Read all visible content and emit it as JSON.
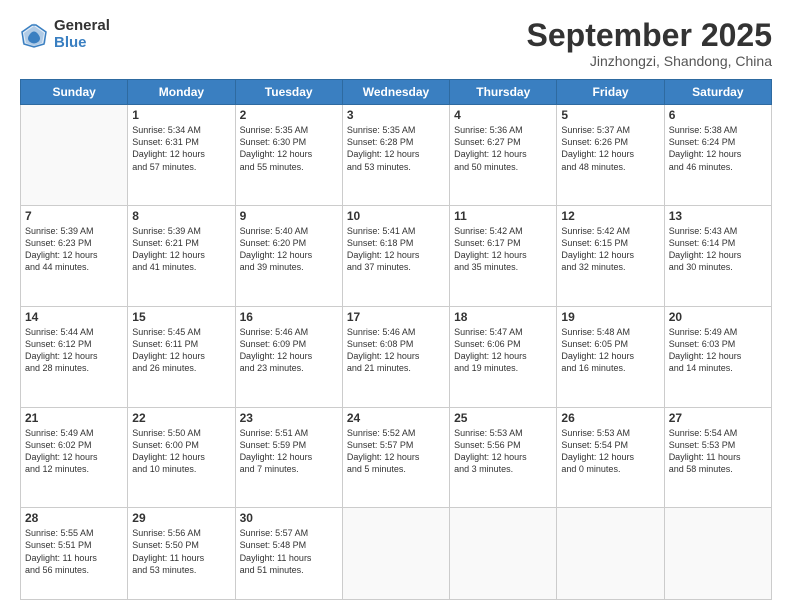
{
  "logo": {
    "general": "General",
    "blue": "Blue"
  },
  "header": {
    "month": "September 2025",
    "location": "Jinzhongzi, Shandong, China"
  },
  "weekdays": [
    "Sunday",
    "Monday",
    "Tuesday",
    "Wednesday",
    "Thursday",
    "Friday",
    "Saturday"
  ],
  "weeks": [
    [
      {
        "num": "",
        "text": ""
      },
      {
        "num": "1",
        "text": "Sunrise: 5:34 AM\nSunset: 6:31 PM\nDaylight: 12 hours\nand 57 minutes."
      },
      {
        "num": "2",
        "text": "Sunrise: 5:35 AM\nSunset: 6:30 PM\nDaylight: 12 hours\nand 55 minutes."
      },
      {
        "num": "3",
        "text": "Sunrise: 5:35 AM\nSunset: 6:28 PM\nDaylight: 12 hours\nand 53 minutes."
      },
      {
        "num": "4",
        "text": "Sunrise: 5:36 AM\nSunset: 6:27 PM\nDaylight: 12 hours\nand 50 minutes."
      },
      {
        "num": "5",
        "text": "Sunrise: 5:37 AM\nSunset: 6:26 PM\nDaylight: 12 hours\nand 48 minutes."
      },
      {
        "num": "6",
        "text": "Sunrise: 5:38 AM\nSunset: 6:24 PM\nDaylight: 12 hours\nand 46 minutes."
      }
    ],
    [
      {
        "num": "7",
        "text": "Sunrise: 5:39 AM\nSunset: 6:23 PM\nDaylight: 12 hours\nand 44 minutes."
      },
      {
        "num": "8",
        "text": "Sunrise: 5:39 AM\nSunset: 6:21 PM\nDaylight: 12 hours\nand 41 minutes."
      },
      {
        "num": "9",
        "text": "Sunrise: 5:40 AM\nSunset: 6:20 PM\nDaylight: 12 hours\nand 39 minutes."
      },
      {
        "num": "10",
        "text": "Sunrise: 5:41 AM\nSunset: 6:18 PM\nDaylight: 12 hours\nand 37 minutes."
      },
      {
        "num": "11",
        "text": "Sunrise: 5:42 AM\nSunset: 6:17 PM\nDaylight: 12 hours\nand 35 minutes."
      },
      {
        "num": "12",
        "text": "Sunrise: 5:42 AM\nSunset: 6:15 PM\nDaylight: 12 hours\nand 32 minutes."
      },
      {
        "num": "13",
        "text": "Sunrise: 5:43 AM\nSunset: 6:14 PM\nDaylight: 12 hours\nand 30 minutes."
      }
    ],
    [
      {
        "num": "14",
        "text": "Sunrise: 5:44 AM\nSunset: 6:12 PM\nDaylight: 12 hours\nand 28 minutes."
      },
      {
        "num": "15",
        "text": "Sunrise: 5:45 AM\nSunset: 6:11 PM\nDaylight: 12 hours\nand 26 minutes."
      },
      {
        "num": "16",
        "text": "Sunrise: 5:46 AM\nSunset: 6:09 PM\nDaylight: 12 hours\nand 23 minutes."
      },
      {
        "num": "17",
        "text": "Sunrise: 5:46 AM\nSunset: 6:08 PM\nDaylight: 12 hours\nand 21 minutes."
      },
      {
        "num": "18",
        "text": "Sunrise: 5:47 AM\nSunset: 6:06 PM\nDaylight: 12 hours\nand 19 minutes."
      },
      {
        "num": "19",
        "text": "Sunrise: 5:48 AM\nSunset: 6:05 PM\nDaylight: 12 hours\nand 16 minutes."
      },
      {
        "num": "20",
        "text": "Sunrise: 5:49 AM\nSunset: 6:03 PM\nDaylight: 12 hours\nand 14 minutes."
      }
    ],
    [
      {
        "num": "21",
        "text": "Sunrise: 5:49 AM\nSunset: 6:02 PM\nDaylight: 12 hours\nand 12 minutes."
      },
      {
        "num": "22",
        "text": "Sunrise: 5:50 AM\nSunset: 6:00 PM\nDaylight: 12 hours\nand 10 minutes."
      },
      {
        "num": "23",
        "text": "Sunrise: 5:51 AM\nSunset: 5:59 PM\nDaylight: 12 hours\nand 7 minutes."
      },
      {
        "num": "24",
        "text": "Sunrise: 5:52 AM\nSunset: 5:57 PM\nDaylight: 12 hours\nand 5 minutes."
      },
      {
        "num": "25",
        "text": "Sunrise: 5:53 AM\nSunset: 5:56 PM\nDaylight: 12 hours\nand 3 minutes."
      },
      {
        "num": "26",
        "text": "Sunrise: 5:53 AM\nSunset: 5:54 PM\nDaylight: 12 hours\nand 0 minutes."
      },
      {
        "num": "27",
        "text": "Sunrise: 5:54 AM\nSunset: 5:53 PM\nDaylight: 11 hours\nand 58 minutes."
      }
    ],
    [
      {
        "num": "28",
        "text": "Sunrise: 5:55 AM\nSunset: 5:51 PM\nDaylight: 11 hours\nand 56 minutes."
      },
      {
        "num": "29",
        "text": "Sunrise: 5:56 AM\nSunset: 5:50 PM\nDaylight: 11 hours\nand 53 minutes."
      },
      {
        "num": "30",
        "text": "Sunrise: 5:57 AM\nSunset: 5:48 PM\nDaylight: 11 hours\nand 51 minutes."
      },
      {
        "num": "",
        "text": ""
      },
      {
        "num": "",
        "text": ""
      },
      {
        "num": "",
        "text": ""
      },
      {
        "num": "",
        "text": ""
      }
    ]
  ]
}
